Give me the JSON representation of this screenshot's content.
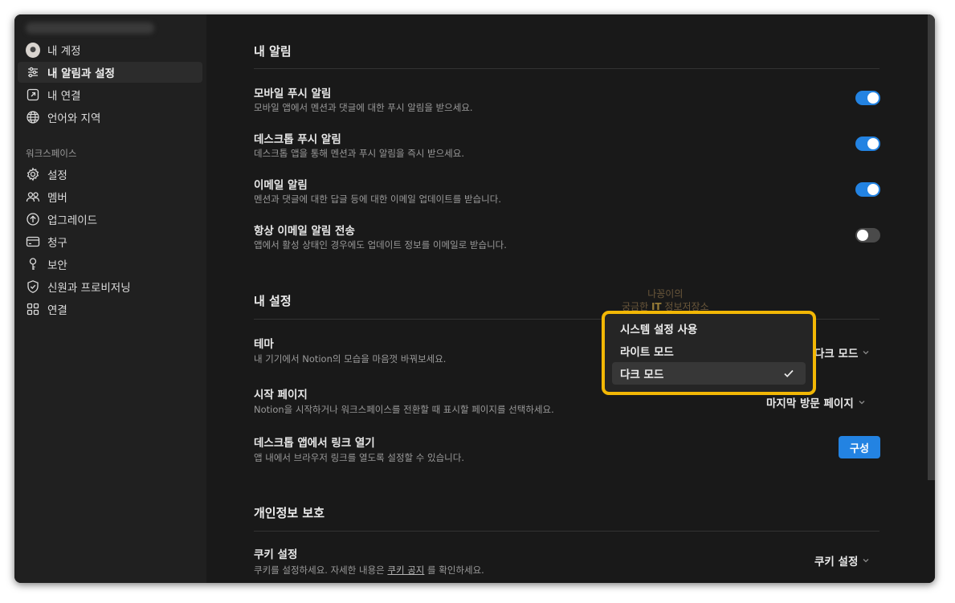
{
  "sidebar": {
    "account_items": [
      {
        "label": "내 계정",
        "icon": "avatar"
      },
      {
        "label": "내 알림과 설정",
        "icon": "sliders-icon",
        "active": true
      },
      {
        "label": "내 연결",
        "icon": "external-link-icon"
      },
      {
        "label": "언어와 지역",
        "icon": "globe-icon"
      }
    ],
    "workspace_label": "워크스페이스",
    "workspace_items": [
      {
        "label": "설정",
        "icon": "gear-icon"
      },
      {
        "label": "멤버",
        "icon": "people-icon"
      },
      {
        "label": "업그레이드",
        "icon": "arrow-up-circle-icon"
      },
      {
        "label": "청구",
        "icon": "credit-card-icon"
      },
      {
        "label": "보안",
        "icon": "key-icon"
      },
      {
        "label": "신원과 프로비저닝",
        "icon": "shield-check-icon"
      },
      {
        "label": "연결",
        "icon": "grid-icon"
      }
    ]
  },
  "notifications": {
    "heading": "내 알림",
    "rows": [
      {
        "title": "모바일 푸시 알림",
        "desc": "모바일 앱에서 멘션과 댓글에 대한 푸시 알림을 받으세요.",
        "enabled": true
      },
      {
        "title": "데스크톱 푸시 알림",
        "desc": "데스크톱 앱을 통해 멘션과 푸시 알림을 즉시 받으세요.",
        "enabled": true
      },
      {
        "title": "이메일 알림",
        "desc": "멘션과 댓글에 대한 답글 등에 대한 이메일 업데이트를 받습니다.",
        "enabled": true
      },
      {
        "title": "항상 이메일 알림 전송",
        "desc": "앱에서 활성 상태인 경우에도 업데이트 정보를 이메일로 받습니다.",
        "enabled": false
      }
    ]
  },
  "settings": {
    "heading": "내 설정",
    "theme": {
      "title": "테마",
      "desc": "내 기기에서 Notion의 모습을 마음껏 바꿔보세요.",
      "value": "다크 모드"
    },
    "start_page": {
      "title": "시작 페이지",
      "desc": "Notion을 시작하거나 워크스페이스를 전환할 때 표시할 페이지를 선택하세요.",
      "value": "마지막 방문 페이지"
    },
    "desktop_links": {
      "title": "데스크톱 앱에서 링크 열기",
      "desc": "앱 내에서 브라우저 링크를 열도록 설정할 수 있습니다.",
      "button": "구성"
    }
  },
  "privacy": {
    "heading": "개인정보 보호",
    "cookie": {
      "title": "쿠키 설정",
      "desc_before": "쿠키를 설정하세요. 자세한 내용은 ",
      "link": "쿠키 공지",
      "desc_after": " 를 확인하세요.",
      "value": "쿠키 설정"
    }
  },
  "theme_dropdown": {
    "options": [
      {
        "label": "시스템 설정 사용",
        "selected": false
      },
      {
        "label": "라이트 모드",
        "selected": false
      },
      {
        "label": "다크 모드",
        "selected": true
      }
    ],
    "highlight_color": "#f2b705"
  },
  "watermark": {
    "line1": "나꽁이의",
    "line2_a": "궁금한 ",
    "line2_it": "IT",
    "line2_b": " 정보저장소"
  },
  "colors": {
    "accent": "#2383e2",
    "background": "#191919",
    "sidebar": "#202020"
  }
}
